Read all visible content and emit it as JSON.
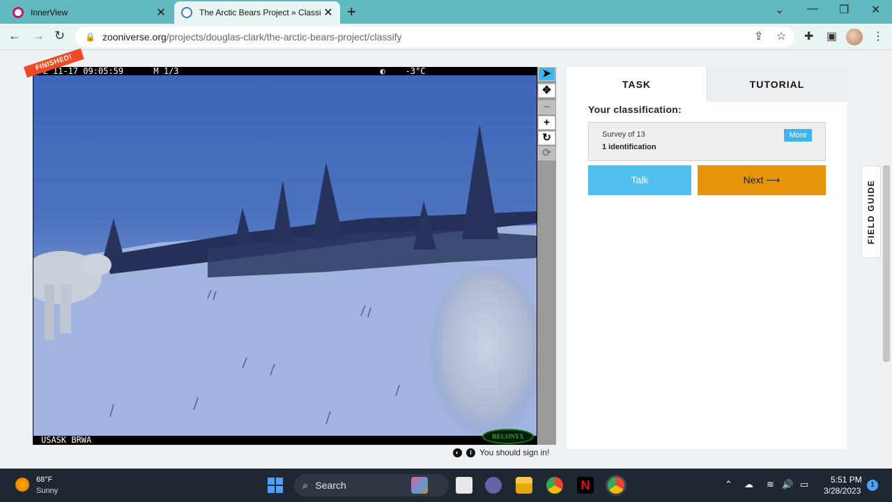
{
  "browser": {
    "tabs": [
      {
        "title": "InnerView",
        "close": "✕"
      },
      {
        "title": "The Arctic Bears Project » Classify",
        "close": "✕"
      }
    ],
    "new_tab": "+",
    "url_host": "zooniverse.org",
    "url_path": "/projects/douglas-clark/the-arctic-bears-project/classify",
    "window_controls": {
      "chevron": "⌄",
      "minimize": "—",
      "restore": "❐",
      "close": "✕"
    },
    "nav": {
      "back": "←",
      "forward": "→",
      "reload": "↻"
    },
    "toolbar_icons": [
      "share-icon",
      "bookmark-star-icon",
      "extensions-icon",
      "side-panel-icon",
      "profile-avatar",
      "menu-icon"
    ]
  },
  "subject": {
    "camera_top": "  2 11-17 09:05:59      M 1/3                                        ◐    -3°C",
    "camera_bottom": "USASK BRWA",
    "reconyx": "RECONYX",
    "finished_badge": "FINISHED!",
    "sign_in_note": "You should sign in!"
  },
  "viewer_tools": [
    {
      "name": "pointer",
      "glyph": "➤"
    },
    {
      "name": "pan",
      "glyph": "✥"
    },
    {
      "name": "zoom-out",
      "glyph": "−"
    },
    {
      "name": "zoom-in",
      "glyph": "+"
    },
    {
      "name": "rotate",
      "glyph": "↻"
    },
    {
      "name": "reset",
      "glyph": "⟳"
    }
  ],
  "panel": {
    "tab_task": "TASK",
    "tab_tutorial": "TUTORIAL",
    "your_classification": "Your classification:",
    "survey_line": "Survey of 13",
    "identification_line": "1 identification",
    "more": "More",
    "talk": "Talk",
    "next": "Next ⟶",
    "field_guide": "FIELD GUIDE"
  },
  "taskbar": {
    "temperature": "68°F",
    "condition": "Sunny",
    "search": "Search",
    "time": "5:51 PM",
    "date": "3/28/2023",
    "notification_count": "1"
  },
  "colors": {
    "accent_blue": "#3fb4ee",
    "next_orange": "#e8940a",
    "finished_red": "#ef4a23",
    "chrome_teal": "#5fb9bf"
  }
}
